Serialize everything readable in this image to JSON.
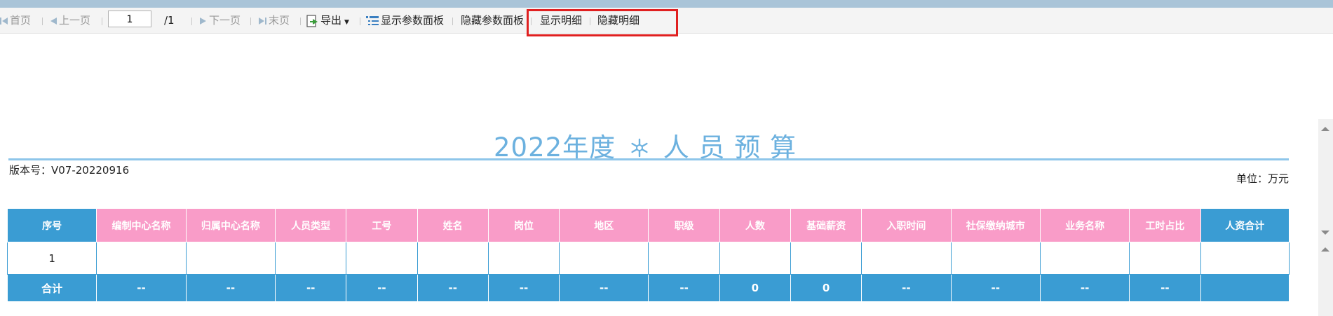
{
  "toolbar": {
    "first": "首页",
    "prev": "上一页",
    "page_value": "1",
    "page_total": "/1",
    "next": "下一页",
    "last": "末页",
    "export": "导出",
    "show_param": "显示参数面板",
    "hide_param": "隐藏参数面板",
    "show_detail": "显示明细",
    "hide_detail": "隐藏明细"
  },
  "report": {
    "title_year": "2022年度",
    "title_main": "人 员 预 算",
    "version": "版本号：V07-20220916",
    "unit": "单位：万元"
  },
  "table": {
    "headers": [
      "序号",
      "编制中心名称",
      "归属中心名称",
      "人员类型",
      "工号",
      "姓名",
      "岗位",
      "地区",
      "职级",
      "人数",
      "基础薪资",
      "入职时间",
      "社保缴纳城市",
      "业务名称",
      "工时占比",
      "人资合计"
    ],
    "header_colors": [
      "blue",
      "pink",
      "pink",
      "pink",
      "pink",
      "pink",
      "pink",
      "pink",
      "pink",
      "pink",
      "pink",
      "pink",
      "pink",
      "pink",
      "pink",
      "blue"
    ],
    "row": [
      "1",
      "",
      "",
      "",
      "",
      "",
      "",
      "",
      "",
      "",
      "",
      "",
      "",
      "",
      "",
      ""
    ],
    "sum": [
      "合计",
      "--",
      "--",
      "--",
      "--",
      "--",
      "--",
      "--",
      "--",
      "0",
      "0",
      "--",
      "--",
      "--",
      "--",
      ""
    ]
  },
  "colors": {
    "header_blue": "#3a9cd3",
    "header_pink": "#f99cc8",
    "title": "#6cb1df",
    "highlight": "#e02020"
  },
  "icons": [
    "first-page-icon",
    "prev-page-icon",
    "next-page-icon",
    "last-page-icon",
    "export-icon",
    "param-panel-icon",
    "snowflake-icon"
  ]
}
